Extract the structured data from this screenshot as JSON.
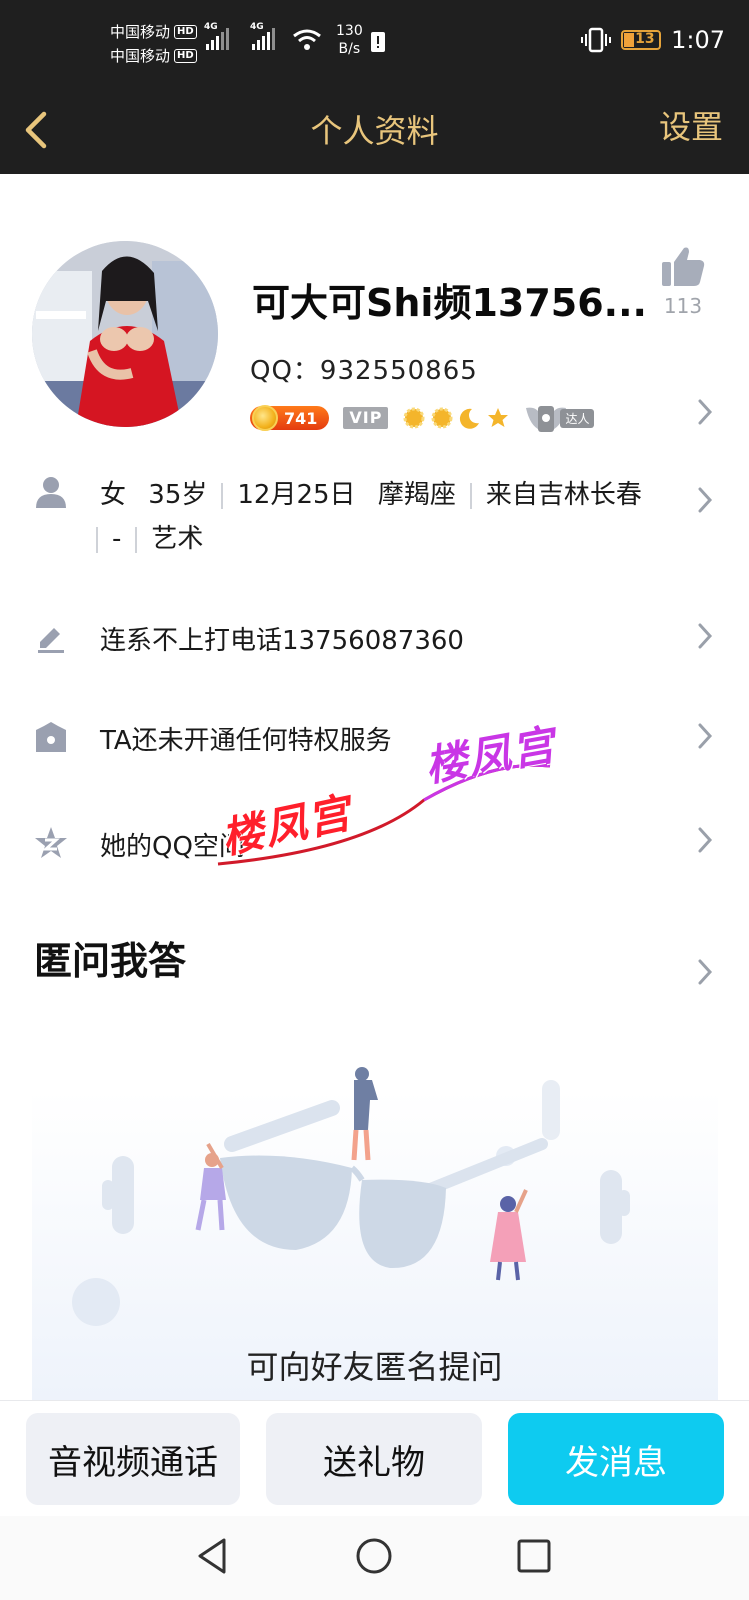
{
  "status_bar": {
    "carrier1": "中国移动",
    "carrier2": "中国移动",
    "hd": "HD",
    "net1": "4G",
    "net2": "4G",
    "speed_value": "130",
    "speed_unit": "B/s",
    "battery": "13",
    "time": "1:07"
  },
  "header": {
    "title": "个人资料",
    "settings": "设置"
  },
  "profile": {
    "nickname": "可大可Shi频13756...",
    "qq": "QQ：932550865",
    "likes": "113",
    "level": "741",
    "vip": "VIP",
    "daren": "达人"
  },
  "info": {
    "gender": "女",
    "age": "35岁",
    "birthday": "12月25日",
    "zodiac": "摩羯座",
    "hometown": "来自吉林长春",
    "dash": "-",
    "occupation": "艺术",
    "signature": "连系不上打电话13756087360",
    "privilege": "TA还未开通任何特权服务",
    "qzone": "她的QQ空间"
  },
  "watermark": {
    "text1": "楼凤宫",
    "text2": "楼凤宫"
  },
  "qa_section": {
    "title": "匿问我答",
    "caption": "可向好友匿名提问"
  },
  "actions": {
    "call": "音视频通话",
    "gift": "送礼物",
    "message": "发消息"
  },
  "colors": {
    "header_bg": "#1f1f1f",
    "header_text": "#e8c57c",
    "primary_button": "#0ecbf0"
  }
}
